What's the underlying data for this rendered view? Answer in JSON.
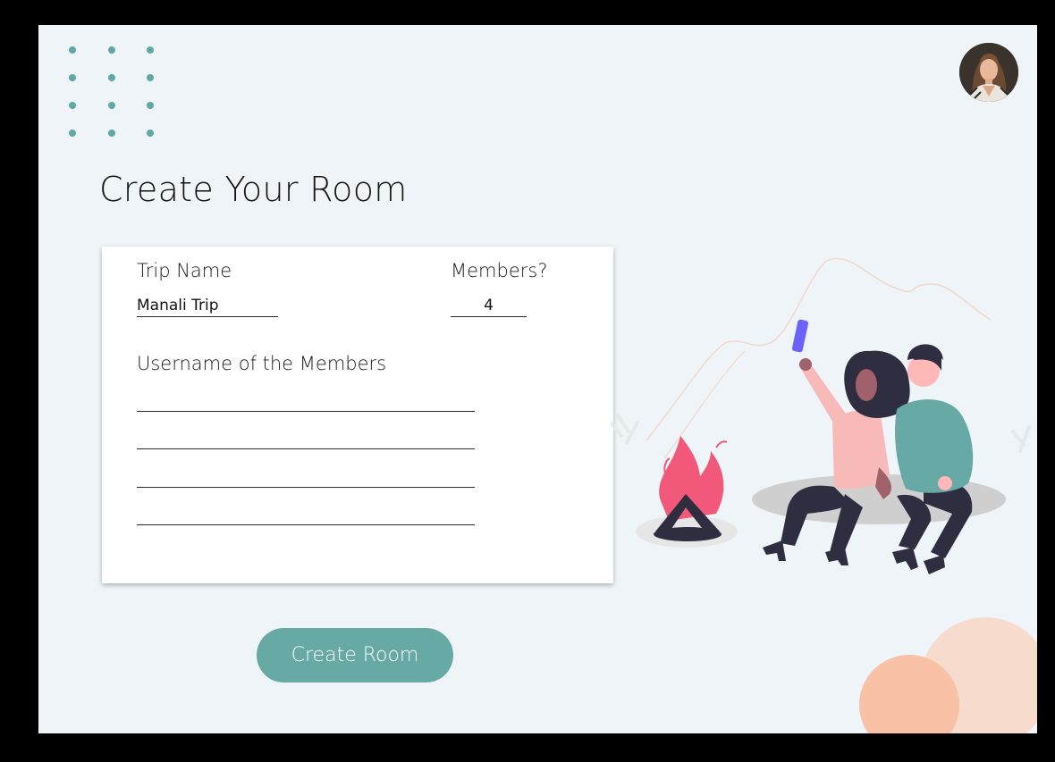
{
  "page": {
    "title": "Create Your Room"
  },
  "form": {
    "trip_name_label": "Trip Name",
    "trip_name_value": "Manali Trip",
    "members_label": "Members?",
    "members_value": "4",
    "usernames_label": "Username of the Members",
    "usernames": [
      "",
      "",
      "",
      ""
    ]
  },
  "actions": {
    "create_label": "Create Room"
  },
  "colors": {
    "accent": "#67a9a5",
    "dots": "#5fa8a3",
    "background": "#eef4f7",
    "peach_light": "#f7dccd",
    "peach": "#f9c1a5",
    "fire": "#f2587a"
  },
  "icons": {
    "profile": "user-avatar",
    "illustration": "campfire-selfie-illustration"
  }
}
